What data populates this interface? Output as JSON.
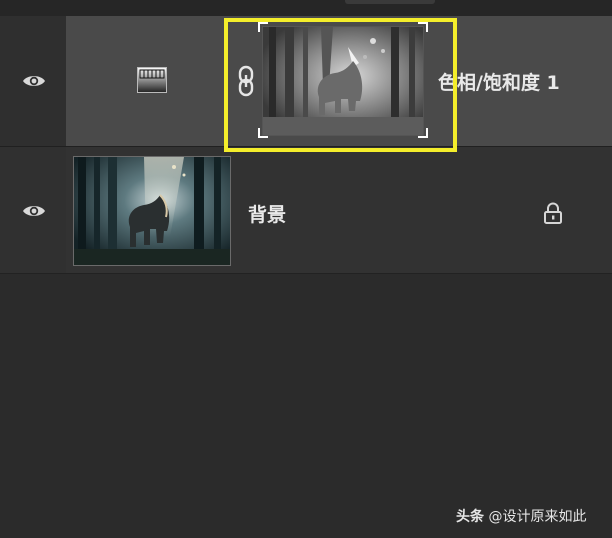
{
  "layers": [
    {
      "name": "色相/饱和度 1",
      "visibility_icon": "eye-icon",
      "adjustment_icon": "hue-saturation-adjustment-icon",
      "link_icon": "chain-link-icon",
      "thumbnail": "grayscale elephant mask",
      "selected": true
    },
    {
      "name": "背景",
      "visibility_icon": "eye-icon",
      "thumbnail": "elephant in forest",
      "lock_icon": "lock-icon"
    }
  ],
  "watermark": {
    "brand": "头条",
    "handle": "@设计原来如此"
  },
  "colors": {
    "panel_bg": "#2b2b2b",
    "selected_row": "#4a4a4a",
    "highlight": "#f4ee2b"
  }
}
